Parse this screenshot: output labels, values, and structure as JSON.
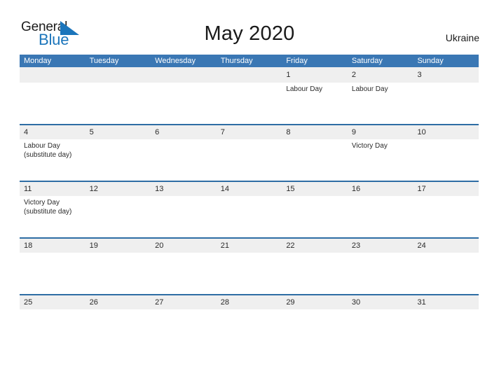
{
  "brand": {
    "name_part1": "General",
    "name_part2": "Blue",
    "flag_icon": "blue-flag-triangle",
    "color_dark": "#1c1c1c",
    "color_blue": "#1b75bb"
  },
  "header": {
    "title": "May 2020",
    "region": "Ukraine"
  },
  "theme": {
    "header_blue": "#3a77b4",
    "divider_blue": "#2e6da4",
    "band_gray": "#efefef",
    "text_dark": "#2a2a2a"
  },
  "calendar": {
    "weekdays": [
      "Monday",
      "Tuesday",
      "Wednesday",
      "Thursday",
      "Friday",
      "Saturday",
      "Sunday"
    ],
    "weeks": [
      {
        "days": [
          {
            "date": "",
            "events": []
          },
          {
            "date": "",
            "events": []
          },
          {
            "date": "",
            "events": []
          },
          {
            "date": "",
            "events": []
          },
          {
            "date": "1",
            "events": [
              "Labour Day"
            ]
          },
          {
            "date": "2",
            "events": [
              "Labour Day"
            ]
          },
          {
            "date": "3",
            "events": []
          }
        ]
      },
      {
        "days": [
          {
            "date": "4",
            "events": [
              "Labour Day",
              "(substitute day)"
            ]
          },
          {
            "date": "5",
            "events": []
          },
          {
            "date": "6",
            "events": []
          },
          {
            "date": "7",
            "events": []
          },
          {
            "date": "8",
            "events": []
          },
          {
            "date": "9",
            "events": [
              "Victory Day"
            ]
          },
          {
            "date": "10",
            "events": []
          }
        ]
      },
      {
        "days": [
          {
            "date": "11",
            "events": [
              "Victory Day",
              "(substitute day)"
            ]
          },
          {
            "date": "12",
            "events": []
          },
          {
            "date": "13",
            "events": []
          },
          {
            "date": "14",
            "events": []
          },
          {
            "date": "15",
            "events": []
          },
          {
            "date": "16",
            "events": []
          },
          {
            "date": "17",
            "events": []
          }
        ]
      },
      {
        "days": [
          {
            "date": "18",
            "events": []
          },
          {
            "date": "19",
            "events": []
          },
          {
            "date": "20",
            "events": []
          },
          {
            "date": "21",
            "events": []
          },
          {
            "date": "22",
            "events": []
          },
          {
            "date": "23",
            "events": []
          },
          {
            "date": "24",
            "events": []
          }
        ]
      },
      {
        "days": [
          {
            "date": "25",
            "events": []
          },
          {
            "date": "26",
            "events": []
          },
          {
            "date": "27",
            "events": []
          },
          {
            "date": "28",
            "events": []
          },
          {
            "date": "29",
            "events": []
          },
          {
            "date": "30",
            "events": []
          },
          {
            "date": "31",
            "events": []
          }
        ]
      }
    ]
  }
}
